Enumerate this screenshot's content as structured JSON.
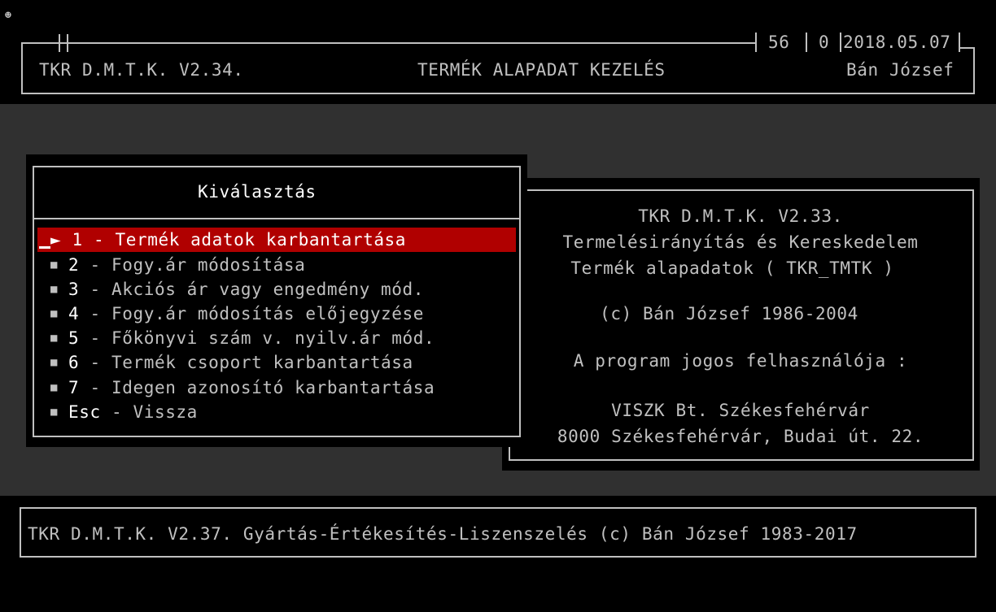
{
  "corner_icon": "smiley-icon",
  "header": {
    "app_name": "TKR D.M.T.K. V2.34.",
    "screen_title": "TERMÉK ALAPADAT KEZELÉS",
    "user": "Bán József",
    "status_num1": "56",
    "status_num2": "0",
    "date": "2018.05.07"
  },
  "menu": {
    "title": "Kiválasztás",
    "selected_index": 0,
    "items": [
      {
        "key": "1",
        "label": " - Termék adatok karbantartása"
      },
      {
        "key": "2",
        "label": " -  Fogy.ár módosítása"
      },
      {
        "key": "3",
        "label": " -  Akciós ár vagy engedmény mód."
      },
      {
        "key": "4",
        "label": " -  Fogy.ár módosítás előjegyzése"
      },
      {
        "key": "5",
        "label": " -  Főkönyvi szám v. nyilv.ár mód."
      },
      {
        "key": "6",
        "label": " - Termék csoport karbantartása"
      },
      {
        "key": "7",
        "label": " - Idegen azonosító karbantartása"
      },
      {
        "key": "Esc",
        "label": " - Vissza"
      }
    ]
  },
  "info": {
    "lines": [
      "TKR D.M.T.K. V2.33.",
      "Termelésirányítás és Kereskedelem",
      "Termék alapadatok ( TKR_TMTK )",
      "(c) Bán József 1986-2004",
      "A program jogos felhasználója :",
      "VISZK Bt. Székesfehérvár",
      "8000 Székesfehérvár, Budai út. 22."
    ]
  },
  "footer": {
    "text": "TKR D.M.T.K. V2.37. Gyártás-Értékesítés-Liszenszelés (c) Bán József 1983-2017"
  }
}
